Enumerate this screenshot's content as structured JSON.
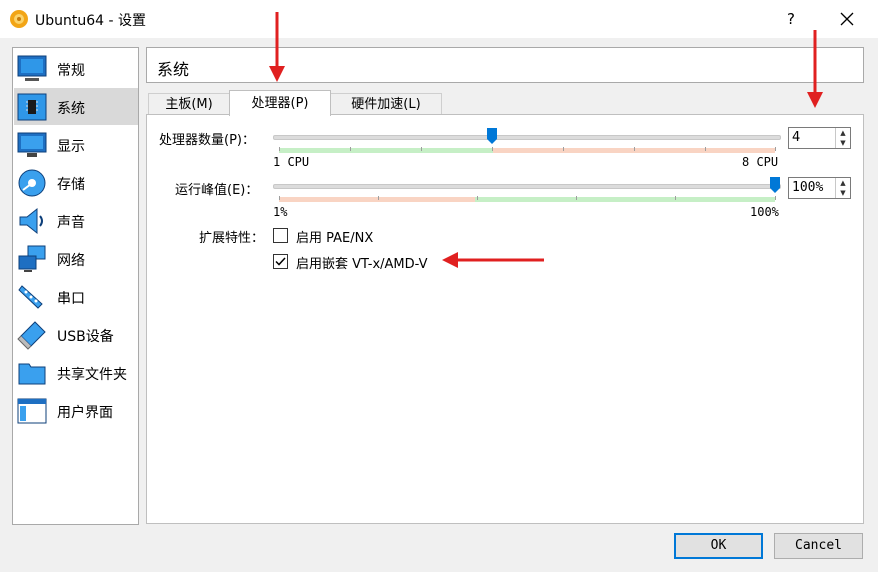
{
  "window": {
    "title": "Ubuntu64 - 设置",
    "help_label": "?",
    "close_label": "✕"
  },
  "sidebar": {
    "items": [
      {
        "label": "常规",
        "icon": "monitor-icon"
      },
      {
        "label": "系统",
        "icon": "chip-icon",
        "selected": true
      },
      {
        "label": "显示",
        "icon": "display-icon"
      },
      {
        "label": "存储",
        "icon": "storage-icon"
      },
      {
        "label": "声音",
        "icon": "speaker-icon"
      },
      {
        "label": "网络",
        "icon": "network-icon"
      },
      {
        "label": "串口",
        "icon": "serial-port-icon"
      },
      {
        "label": "USB设备",
        "icon": "usb-icon"
      },
      {
        "label": "共享文件夹",
        "icon": "folder-icon"
      },
      {
        "label": "用户界面",
        "icon": "window-icon"
      }
    ]
  },
  "header": {
    "title": "系统"
  },
  "tabs": [
    {
      "label": "主板(M)",
      "active": false
    },
    {
      "label": "处理器(P)",
      "active": true
    },
    {
      "label": "硬件加速(L)",
      "active": false
    }
  ],
  "processor": {
    "cpu_count_label": "处理器数量(P)：",
    "cpu_count_value": "4",
    "cpu_min_label": "1 CPU",
    "cpu_max_label": "8 CPU",
    "cpu_level": 0.43,
    "exec_cap_label": "运行峰值(E)：",
    "exec_cap_value": "100%",
    "exec_cap_min_label": "1%",
    "exec_cap_max_label": "100%",
    "exec_cap_level": 1.0,
    "ext_features_label": "扩展特性：",
    "pae_label": "启用 PAE/NX",
    "pae_checked": false,
    "nested_label": "启用嵌套 VT-x/AMD-V",
    "nested_checked": true
  },
  "buttons": {
    "ok_label": "OK",
    "cancel_label": "Cancel"
  },
  "colors": {
    "accent": "#0078d7",
    "annotation_arrow": "#e02020",
    "range_good": "#c6efc6",
    "range_warn": "#f9d4c3"
  }
}
